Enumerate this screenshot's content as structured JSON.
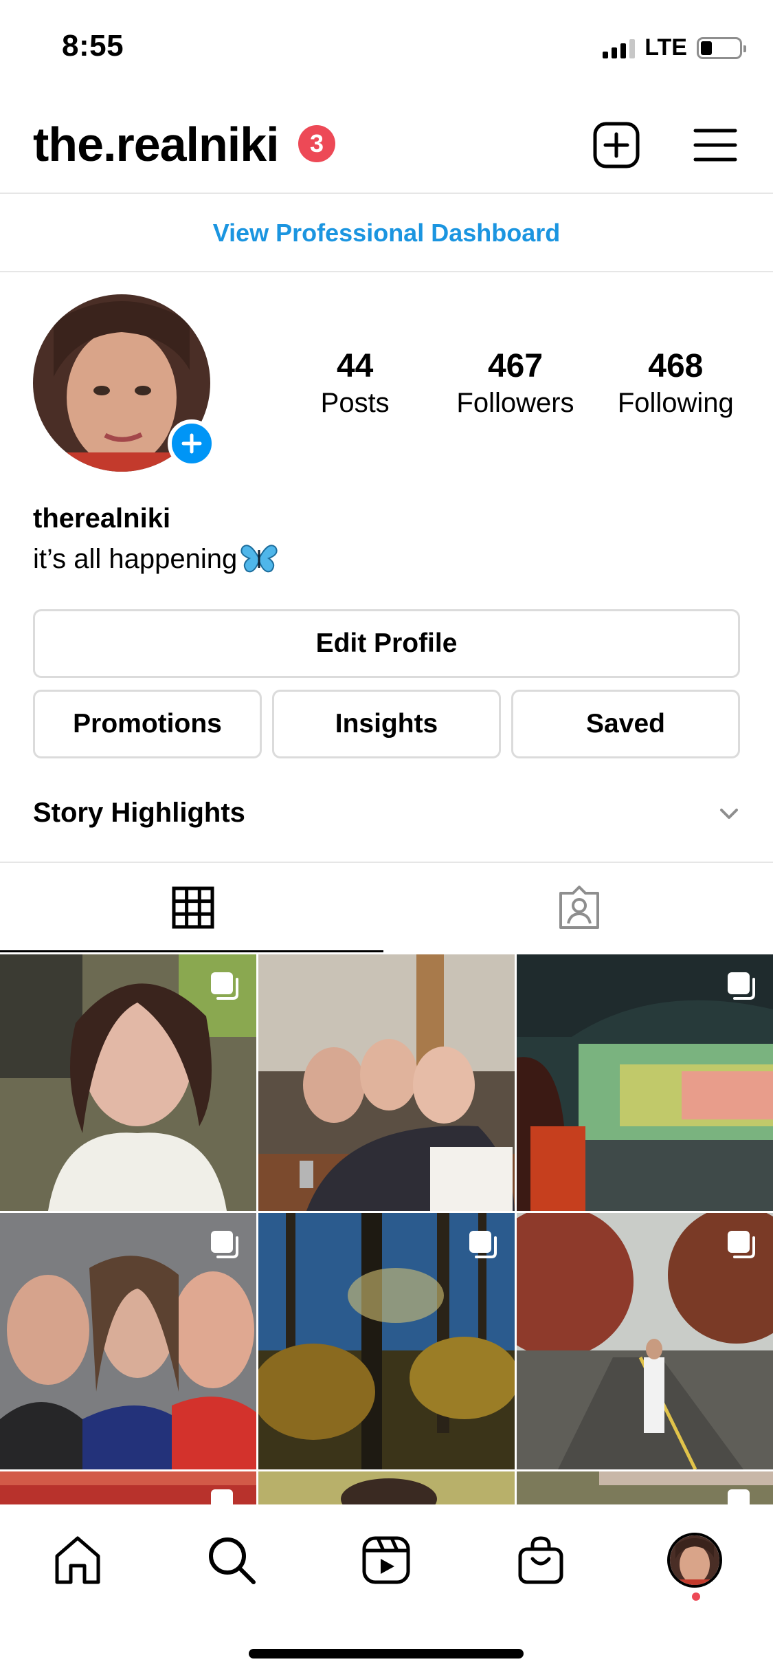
{
  "status_bar": {
    "time": "8:55",
    "network": "LTE",
    "battery_level": 0.3
  },
  "header": {
    "username": "the.realniki",
    "notification_count": "3"
  },
  "dashboard": {
    "label": "View Professional Dashboard"
  },
  "profile": {
    "posts_count": "44",
    "posts_label": "Posts",
    "followers_count": "467",
    "followers_label": "Followers",
    "following_count": "468",
    "following_label": "Following",
    "name": "therealniki",
    "bio": "it’s all happening"
  },
  "buttons": {
    "edit_profile": "Edit Profile",
    "promotions": "Promotions",
    "insights": "Insights",
    "saved": "Saved"
  },
  "highlights": {
    "title": "Story Highlights"
  },
  "colors": {
    "link": "#1b95e0",
    "badge": "#ed4956",
    "accent": "#0095f6",
    "border": "#dbdbdb"
  },
  "icons": {
    "header": [
      "new-post-icon",
      "menu-icon"
    ],
    "tabs": [
      "grid-icon",
      "tagged-icon"
    ],
    "nav": [
      "home-icon",
      "search-icon",
      "reels-icon",
      "shop-icon",
      "profile-avatar"
    ]
  }
}
